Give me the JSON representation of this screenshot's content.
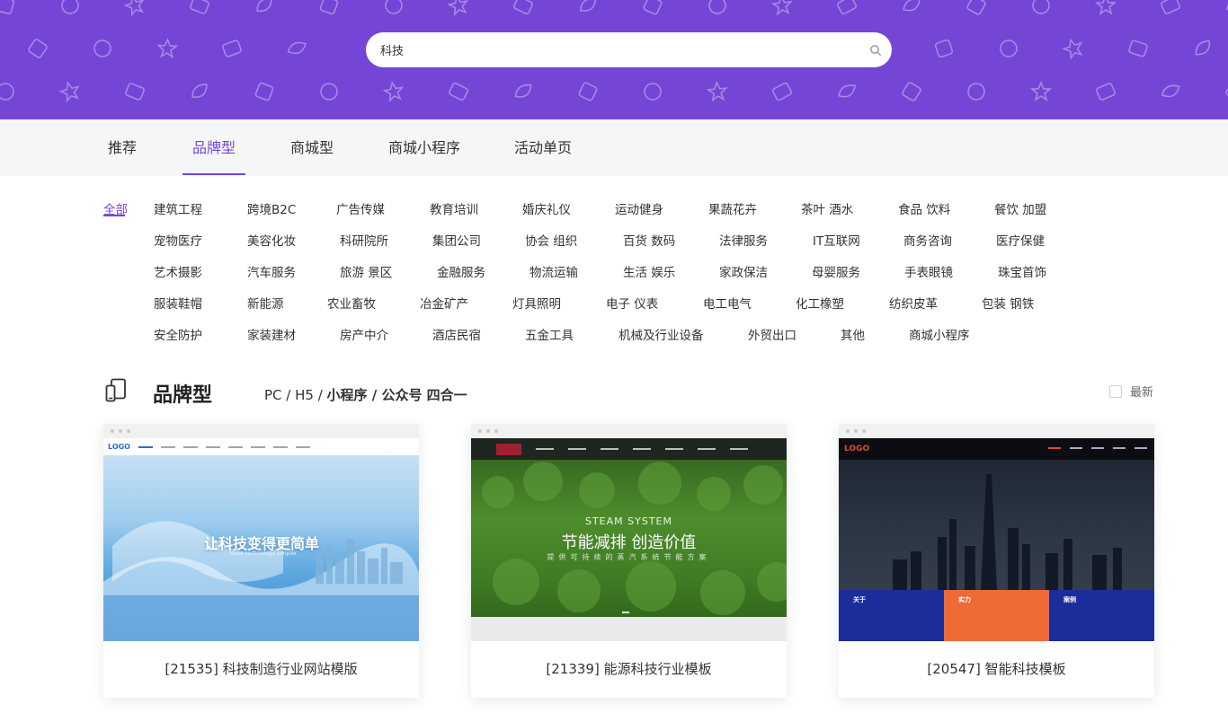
{
  "search": {
    "value": "科技",
    "icon": "search-icon"
  },
  "tabs": [
    {
      "label": "推荐",
      "active": false
    },
    {
      "label": "品牌型",
      "active": true
    },
    {
      "label": "商城型",
      "active": false
    },
    {
      "label": "商城小程序",
      "active": false
    },
    {
      "label": "活动单页",
      "active": false
    }
  ],
  "categories": [
    [
      "全部",
      "建筑工程",
      "跨境B2C",
      "广告传媒",
      "教育培训",
      "婚庆礼仪",
      "运动健身",
      "果蔬花卉",
      "茶叶 酒水",
      "食品 饮料",
      "餐饮 加盟"
    ],
    [
      "宠物医疗",
      "美容化妆",
      "科研院所",
      "集团公司",
      "协会 组织",
      "百货 数码",
      "法律服务",
      "IT互联网",
      "商务咨询",
      "医疗保健"
    ],
    [
      "艺术摄影",
      "汽车服务",
      "旅游 景区",
      "金融服务",
      "物流运输",
      "生活 娱乐",
      "家政保洁",
      "母婴服务",
      "手表眼镜",
      "珠宝首饰"
    ],
    [
      "服装鞋帽",
      "新能源",
      "农业畜牧",
      "冶金矿产",
      "灯具照明",
      "电子 仪表",
      "电工电气",
      "化工橡塑",
      "纺织皮革",
      "包装 钢铁"
    ],
    [
      "安全防护",
      "家装建材",
      "房产中介",
      "酒店民宿",
      "五金工具",
      "机械及行业设备",
      "外贸出口",
      "其他",
      "商城小程序"
    ]
  ],
  "section": {
    "icon": "devices-icon",
    "title": "品牌型",
    "subtitle_light": "PC / H5 / ",
    "subtitle_bold": "小程序 / 公众号 四合一",
    "latest_label": "最新"
  },
  "cards": [
    {
      "caption": "[21535] 科技制造行业网站模版",
      "preview": {
        "logo": "LOGO",
        "headline": "让科技变得更简单",
        "subline": "Make technology simpler"
      }
    },
    {
      "caption": "[21339] 能源科技行业模板",
      "preview": {
        "line1": "STEAM SYSTEM",
        "line2": "节能减排 创造价值",
        "line3": "提供可持续的蒸汽系统节能方案"
      }
    },
    {
      "caption": "[20547] 智能科技模板",
      "preview": {
        "logo": "LOGO",
        "panel1": "关于",
        "panel2": "实力",
        "panel3": "案例"
      }
    }
  ],
  "colors": {
    "accent": "#7546d6",
    "banner": "#7546d6",
    "tabbar": "#f5f6f8"
  }
}
